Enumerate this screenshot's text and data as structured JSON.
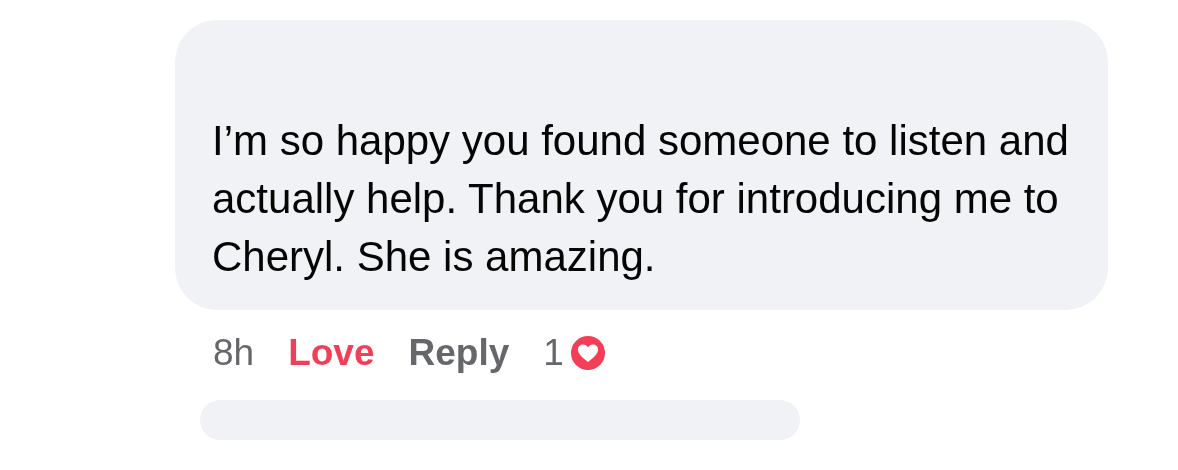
{
  "comment": {
    "text": "I’m so happy you found someone to listen and actually help. Thank you for introducing me to Cheryl. She is amazing.",
    "time": "8h",
    "actions": [
      {
        "label": "Love",
        "kind": "reaction",
        "selected": true
      },
      {
        "label": "Reply",
        "kind": "reply"
      }
    ],
    "reaction_count": "1"
  }
}
